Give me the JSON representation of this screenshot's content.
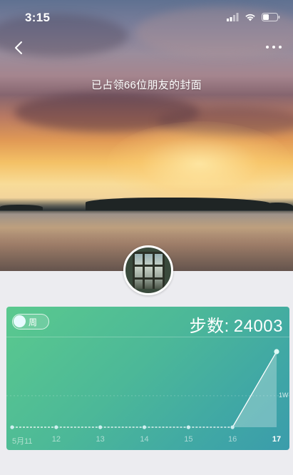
{
  "status_bar": {
    "time": "3:15",
    "icons": [
      "cellular-signal-icon",
      "wifi-icon",
      "battery-icon"
    ]
  },
  "nav": {
    "back_icon": "chevron-left-icon",
    "more_icon": "more-dots-icon"
  },
  "cover": {
    "caption": "已占领66位朋友的封面"
  },
  "card": {
    "toggle_label": "周",
    "toggle_on": true,
    "steps_label": "步数",
    "steps_colon": ":",
    "steps_value": "24003",
    "colors": {
      "gradient_start": "#5ac98e",
      "gradient_end": "#3b9cab",
      "line": "#ffffff"
    }
  },
  "chart_data": {
    "type": "area",
    "categories": [
      "5月11",
      "12",
      "13",
      "14",
      "15",
      "16",
      "17"
    ],
    "values": [
      0,
      0,
      0,
      0,
      0,
      0,
      24003
    ],
    "highlighted_category": "17",
    "reference_line": {
      "label": "1W",
      "value": 10000
    },
    "ylim": [
      0,
      24003
    ],
    "grid": false
  }
}
